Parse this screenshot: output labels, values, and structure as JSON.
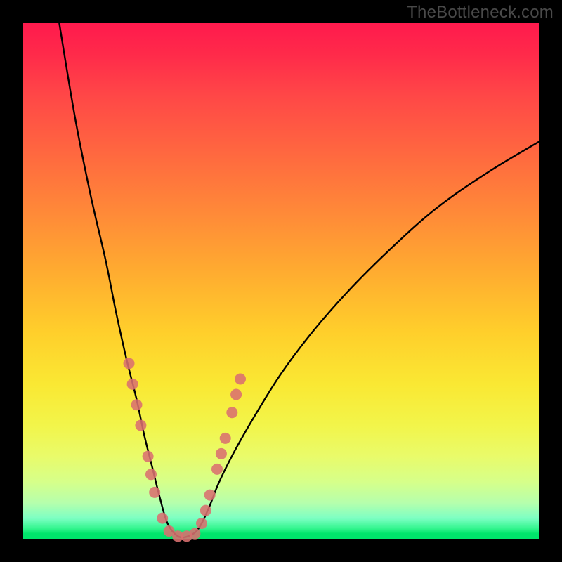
{
  "watermark": "TheBottleneck.com",
  "chart_data": {
    "type": "line",
    "title": "",
    "xlabel": "",
    "ylabel": "",
    "xlim": [
      0,
      100
    ],
    "ylim": [
      0,
      100
    ],
    "grid": false,
    "legend": false,
    "note": "Axes are unlabeled; values are pixel-fractions of the 734×734 plot area (0=left/top, 100=right/bottom). Curve is a V shape: steep descent from top-left down to a flat trough near x≈27–34%, then a shallower ascent toward the right edge.",
    "series": [
      {
        "name": "bottleneck-curve",
        "x": [
          7,
          10,
          13,
          16,
          18,
          20,
          22,
          23.5,
          25,
          26.5,
          28,
          30,
          32,
          34,
          36,
          38,
          41,
          45,
          50,
          56,
          63,
          71,
          80,
          90,
          100
        ],
        "y": [
          0,
          18,
          33,
          46,
          56,
          65,
          73,
          80,
          86,
          92,
          97,
          99.5,
          99.5,
          98,
          94,
          89,
          83,
          76,
          68,
          60,
          52,
          44,
          36,
          29,
          23
        ]
      }
    ],
    "markers": {
      "name": "highlight-dots",
      "color": "#d96f6f",
      "radius_px": 8,
      "points_xy_pct": [
        [
          20.5,
          66
        ],
        [
          21.2,
          70
        ],
        [
          22.0,
          74
        ],
        [
          22.8,
          78
        ],
        [
          24.2,
          84
        ],
        [
          24.8,
          87.5
        ],
        [
          25.5,
          91
        ],
        [
          27.0,
          96
        ],
        [
          28.3,
          98.5
        ],
        [
          30.0,
          99.5
        ],
        [
          31.7,
          99.5
        ],
        [
          33.3,
          99.0
        ],
        [
          34.6,
          97
        ],
        [
          35.4,
          94.5
        ],
        [
          36.2,
          91.5
        ],
        [
          37.6,
          86.5
        ],
        [
          38.4,
          83.5
        ],
        [
          39.2,
          80.5
        ],
        [
          40.5,
          75.5
        ],
        [
          41.3,
          72
        ],
        [
          42.1,
          69
        ]
      ]
    },
    "gradient_colors": {
      "top": "#ff1a4d",
      "mid": "#ffcf2b",
      "bottom": "#00e56b"
    }
  }
}
